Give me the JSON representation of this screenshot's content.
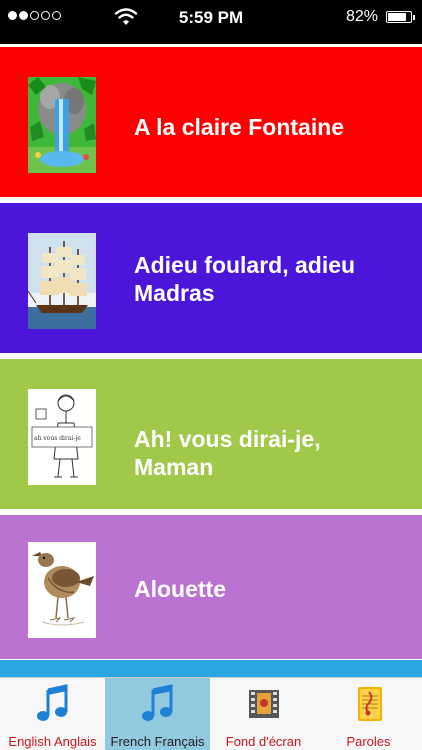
{
  "status_bar": {
    "time": "5:59 PM",
    "battery_percent": "82%",
    "signal_filled_dots": 2,
    "signal_total_dots": 5
  },
  "songs": [
    {
      "title": "A la claire Fontaine",
      "color": "#fd0000",
      "thumbnail": "waterfall"
    },
    {
      "title": "Adieu foulard, adieu Madras",
      "color": "#4b16d9",
      "thumbnail": "sailing-ship"
    },
    {
      "title": "Ah! vous dirai-je, Maman",
      "color": "#a0c94a",
      "thumbnail": "child-sketch"
    },
    {
      "title": "Alouette",
      "color": "#ba73d0",
      "thumbnail": "lark-bird"
    }
  ],
  "tabs": [
    {
      "label": "English Anglais",
      "icon": "music-note-icon",
      "selected": false
    },
    {
      "label": "French Français",
      "icon": "music-note-icon",
      "selected": true
    },
    {
      "label": "Fond d'écran",
      "icon": "film-icon",
      "selected": false
    },
    {
      "label": "Paroles",
      "icon": "sheet-music-icon",
      "selected": false
    }
  ],
  "colors": {
    "strip": "#2aa6e0",
    "tab_label": "#c8161d",
    "tab_selected_bg": "#91c9df"
  }
}
